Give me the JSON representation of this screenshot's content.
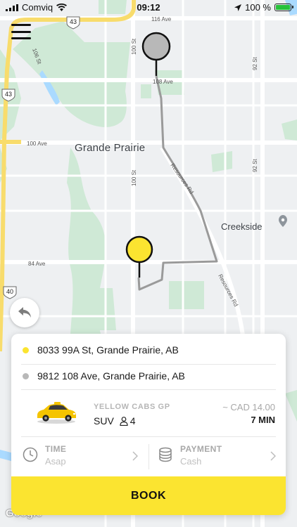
{
  "status_bar": {
    "carrier": "Comviq",
    "time": "09:12",
    "battery": "100 %",
    "battery_level": 1.0
  },
  "map": {
    "city_label": "Grande Prairie",
    "place_label": "Creekside",
    "streets": [
      "116 Ave",
      "108 Ave",
      "100 Ave",
      "84 Ave",
      "100 St",
      "92 St",
      "106 St",
      "Resources Rd"
    ],
    "highways": [
      "43",
      "43",
      "40"
    ],
    "attribution": "Google",
    "route_color": "#9a9a9a",
    "pickup_pin_color": "#fbe430",
    "dropoff_pin_color": "#b8b8b8"
  },
  "booking": {
    "pickup_address": "8033 99A St, Grande Prairie, AB",
    "dropoff_address": "9812 108 Ave, Grande Prairie, AB",
    "company": "YELLOW CABS GP",
    "car_type": "SUV",
    "seats": "4",
    "price": "~ CAD 14.00",
    "duration": "7 MIN",
    "time_label": "TIME",
    "time_value": "Asap",
    "payment_label": "PAYMENT",
    "payment_value": "Cash",
    "book_label": "BOOK",
    "accent": "#fbe430"
  }
}
